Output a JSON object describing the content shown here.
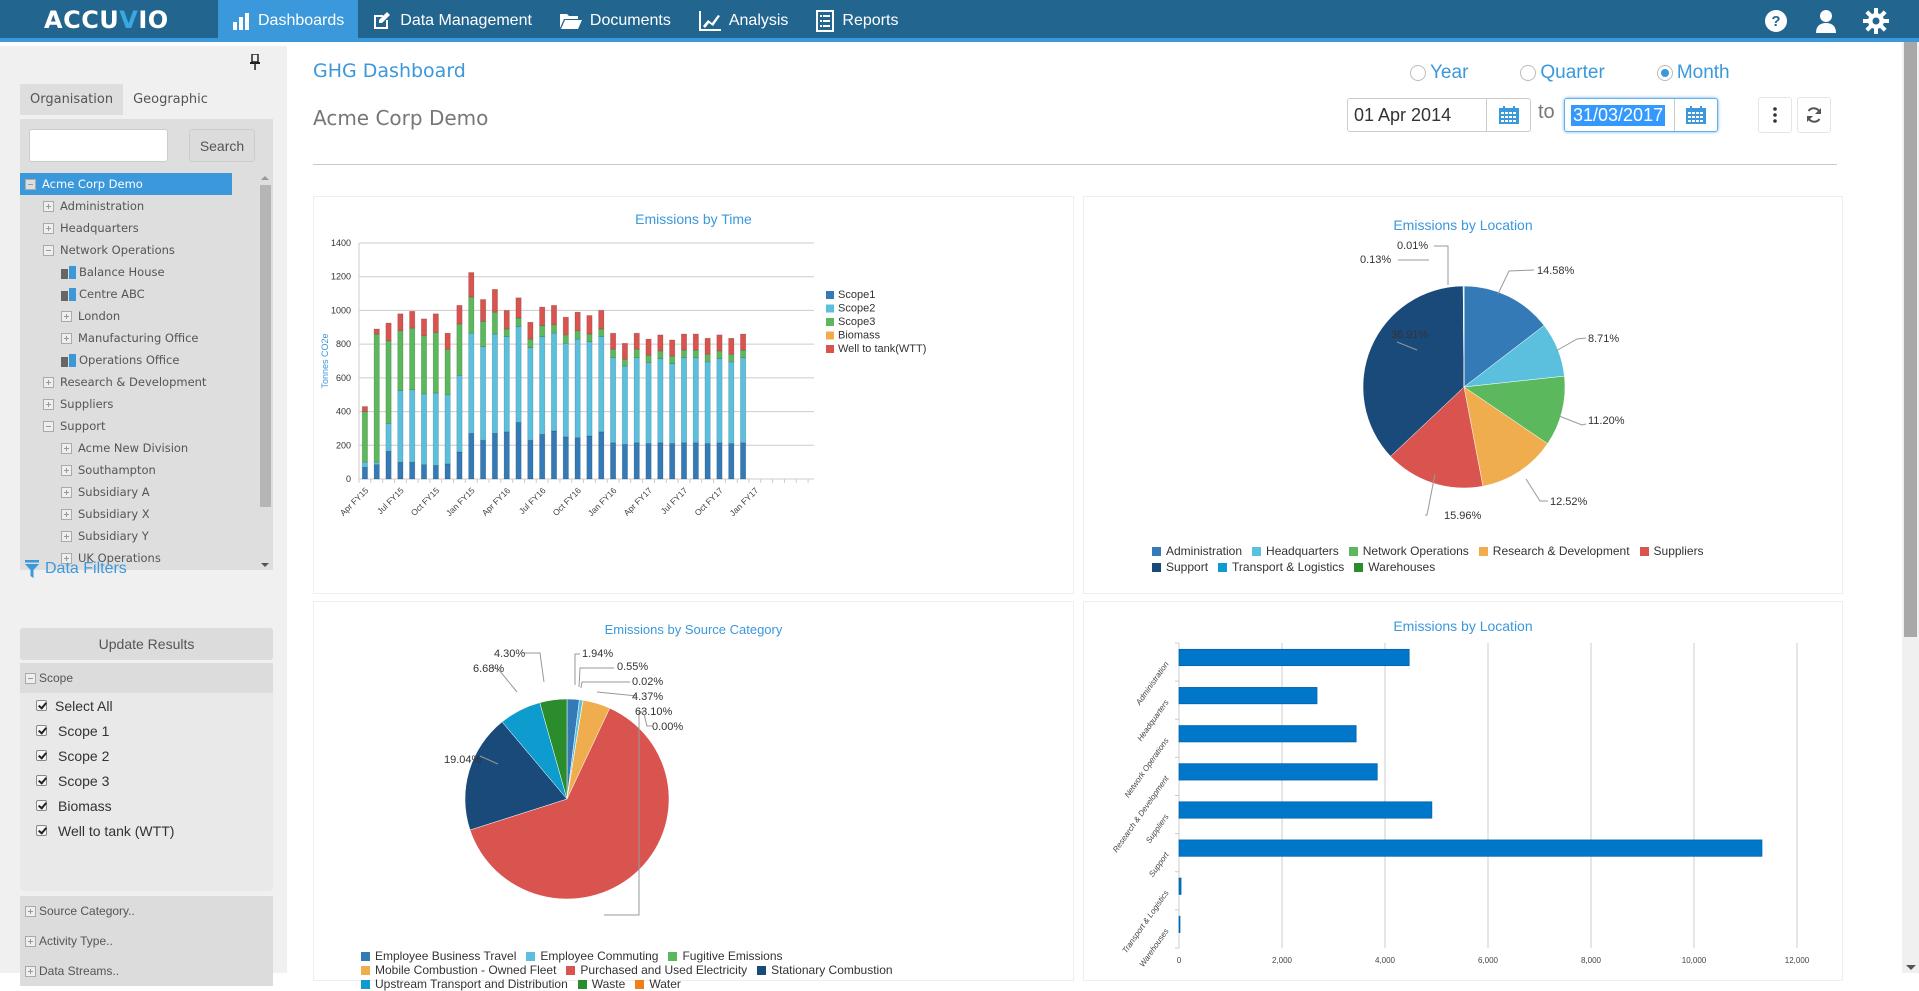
{
  "app": {
    "logo": "ACCUVIO",
    "nav": [
      {
        "label": "Dashboards",
        "icon": "bar-chart-icon",
        "active": true
      },
      {
        "label": "Data Management",
        "icon": "edit-icon",
        "active": false
      },
      {
        "label": "Documents",
        "icon": "folder-open-icon",
        "active": false
      },
      {
        "label": "Analysis",
        "icon": "line-chart-icon",
        "active": false
      },
      {
        "label": "Reports",
        "icon": "list-icon",
        "active": false
      }
    ],
    "top_icons": [
      "help-icon",
      "user-icon",
      "settings-gear-icon"
    ]
  },
  "sidebar": {
    "tabs": [
      {
        "label": "Organisation",
        "active": true
      },
      {
        "label": "Geographic",
        "active": false
      }
    ],
    "search": {
      "value": "",
      "placeholder": "",
      "button": "Search"
    },
    "tree": [
      {
        "label": "Acme Corp Demo",
        "level": 0,
        "type": "collapse",
        "selected": true
      },
      {
        "label": "Administration",
        "level": 1,
        "type": "expand"
      },
      {
        "label": "Headquarters",
        "level": 1,
        "type": "expand"
      },
      {
        "label": "Network Operations",
        "level": 1,
        "type": "collapse"
      },
      {
        "label": "Balance House",
        "level": 2,
        "type": "building"
      },
      {
        "label": "Centre ABC",
        "level": 2,
        "type": "building"
      },
      {
        "label": "London",
        "level": 2,
        "type": "expand"
      },
      {
        "label": "Manufacturing Office",
        "level": 2,
        "type": "expand"
      },
      {
        "label": "Operations Office",
        "level": 2,
        "type": "building"
      },
      {
        "label": "Research & Development",
        "level": 1,
        "type": "expand"
      },
      {
        "label": "Suppliers",
        "level": 1,
        "type": "expand"
      },
      {
        "label": "Support",
        "level": 1,
        "type": "collapse"
      },
      {
        "label": "Acme New Division",
        "level": 2,
        "type": "expand"
      },
      {
        "label": "Southampton",
        "level": 2,
        "type": "expand"
      },
      {
        "label": "Subsidiary A",
        "level": 2,
        "type": "expand"
      },
      {
        "label": "Subsidiary X",
        "level": 2,
        "type": "expand"
      },
      {
        "label": "Subsidiary Y",
        "level": 2,
        "type": "expand"
      },
      {
        "label": "UK Operations",
        "level": 2,
        "type": "expand"
      }
    ],
    "filters": {
      "title": "Data Filters",
      "update_button": "Update Results",
      "scope": {
        "label": "Scope",
        "options": [
          {
            "label": "Select All",
            "checked": true
          },
          {
            "label": "Scope 1",
            "checked": true
          },
          {
            "label": "Scope 2",
            "checked": true
          },
          {
            "label": "Scope 3",
            "checked": true
          },
          {
            "label": "Biomass",
            "checked": true
          },
          {
            "label": "Well to tank (WTT)",
            "checked": true
          }
        ]
      },
      "collapsed": [
        "Source Category..",
        "Activity Type..",
        "Data Streams.."
      ]
    }
  },
  "header": {
    "title": "GHG Dashboard",
    "org": "Acme Corp Demo",
    "period_options": [
      {
        "label": "Year",
        "selected": false
      },
      {
        "label": "Quarter",
        "selected": false
      },
      {
        "label": "Month",
        "selected": true
      }
    ],
    "date_from": "01 Apr 2014",
    "to_label": "to",
    "date_to": "31/03/2017"
  },
  "chart_data": [
    {
      "type": "bar",
      "stacked": true,
      "title": "Emissions by Time",
      "ylabel": "Tonnes CO2e",
      "xlabel": "",
      "ylim": [
        0,
        1400
      ],
      "yticks": [
        0,
        200,
        400,
        600,
        800,
        1000,
        1200,
        1400
      ],
      "grid": true,
      "legend": "right",
      "slots": 36,
      "tick_labels": [
        {
          "slot": 0,
          "label": "Apr FY15"
        },
        {
          "slot": 3,
          "label": "Jul FY15"
        },
        {
          "slot": 6,
          "label": "Oct FY15"
        },
        {
          "slot": 9,
          "label": "Jan FY15"
        },
        {
          "slot": 12,
          "label": "Apr FY16"
        },
        {
          "slot": 15,
          "label": "Jul FY16"
        },
        {
          "slot": 18,
          "label": "Oct FY16"
        },
        {
          "slot": 21,
          "label": "Jan FY16"
        },
        {
          "slot": 24,
          "label": "Apr FY17"
        },
        {
          "slot": 27,
          "label": "Jul FY17"
        },
        {
          "slot": 30,
          "label": "Oct FY17"
        },
        {
          "slot": 33,
          "label": "Jan FY17"
        }
      ],
      "series": [
        {
          "name": "Scope1",
          "color": "#337ab7",
          "values": [
            70,
            85,
            165,
            100,
            100,
            85,
            80,
            90,
            160,
            270,
            230,
            270,
            280,
            335,
            230,
            265,
            285,
            250,
            245,
            255,
            280,
            215,
            205,
            215,
            210,
            215,
            210,
            215,
            215,
            210,
            215,
            210,
            215
          ]
        },
        {
          "name": "Scope2",
          "color": "#5bc0de",
          "values": [
            30,
            15,
            165,
            425,
            430,
            420,
            430,
            410,
            455,
            595,
            555,
            590,
            565,
            570,
            550,
            580,
            580,
            555,
            585,
            560,
            565,
            505,
            465,
            505,
            480,
            500,
            475,
            505,
            505,
            485,
            500,
            485,
            505
          ]
        },
        {
          "name": "Scope3",
          "color": "#5cb85c",
          "values": [
            300,
            760,
            490,
            355,
            365,
            345,
            360,
            270,
            305,
            215,
            150,
            130,
            45,
            50,
            50,
            65,
            50,
            50,
            50,
            45,
            45,
            50,
            40,
            50,
            45,
            45,
            45,
            45,
            45,
            45,
            45,
            45,
            45
          ]
        },
        {
          "name": "Biomass",
          "color": "#f0ad4e",
          "values": [
            0,
            0,
            0,
            0,
            0,
            0,
            0,
            0,
            0,
            0,
            0,
            0,
            0,
            0,
            0,
            0,
            0,
            0,
            0,
            0,
            0,
            0,
            0,
            0,
            0,
            0,
            0,
            0,
            0,
            0,
            0,
            0,
            0
          ]
        },
        {
          "name": "Well to tank(WTT)",
          "color": "#d9534f",
          "values": [
            30,
            30,
            105,
            100,
            100,
            100,
            110,
            95,
            110,
            145,
            130,
            135,
            110,
            120,
            100,
            110,
            115,
            105,
            110,
            110,
            110,
            95,
            95,
            95,
            95,
            95,
            95,
            95,
            95,
            95,
            95,
            95,
            95
          ]
        }
      ]
    },
    {
      "type": "pie",
      "title": "Emissions by Location",
      "legend": "bottom",
      "slices": [
        {
          "label": "Administration",
          "value": 14.58,
          "color": "#337ab7"
        },
        {
          "label": "Headquarters",
          "value": 8.71,
          "color": "#5bc0de"
        },
        {
          "label": "Network Operations",
          "value": 11.2,
          "color": "#5cb85c"
        },
        {
          "label": "Research & Development",
          "value": 12.52,
          "color": "#f0ad4e"
        },
        {
          "label": "Suppliers",
          "value": 15.96,
          "color": "#d9534f"
        },
        {
          "label": "Support",
          "value": 36.91,
          "color": "#1a4a7a"
        },
        {
          "label": "Transport & Logistics",
          "value": 0.13,
          "color": "#0e9ccf"
        },
        {
          "label": "Warehouses",
          "value": 0.01,
          "color": "#2a8c2a"
        }
      ]
    },
    {
      "type": "pie",
      "title": "Emissions by Source Category",
      "legend": "bottom",
      "slices": [
        {
          "label": "Employee Business Travel",
          "value": 1.94,
          "color": "#337ab7"
        },
        {
          "label": "Employee Commuting",
          "value": 0.55,
          "color": "#5bc0de"
        },
        {
          "label": "Fugitive Emissions",
          "value": 0.02,
          "color": "#5cb85c"
        },
        {
          "label": "Mobile Combustion - Owned Fleet",
          "value": 4.37,
          "color": "#f0ad4e"
        },
        {
          "label": "Purchased and Used Electricity",
          "value": 63.1,
          "color": "#d9534f"
        },
        {
          "label": "Stationary Combustion",
          "value": 19.04,
          "color": "#1a4a7a"
        },
        {
          "label": "Upstream Transport and Distribution",
          "value": 6.68,
          "color": "#0e9ccf"
        },
        {
          "label": "Waste",
          "value": 4.3,
          "color": "#2a8c2a"
        },
        {
          "label": "Water",
          "value": 0.0,
          "color": "#f07f1a"
        }
      ]
    },
    {
      "type": "bar",
      "orientation": "horizontal",
      "title": "Emissions by Location",
      "xlim": [
        0,
        12000
      ],
      "xticks": [
        "0",
        "2,000",
        "4,000",
        "6,000",
        "8,000",
        "10,000",
        "12,000"
      ],
      "grid": true,
      "color": "#0077c8",
      "categories": [
        "Administration",
        "Headquarters",
        "Network Operations",
        "Research & Development",
        "Suppliers",
        "Support",
        "Transport & Logistics",
        "Warehouses"
      ],
      "values": [
        4470,
        2680,
        3440,
        3850,
        4910,
        11320,
        40,
        5
      ]
    }
  ]
}
